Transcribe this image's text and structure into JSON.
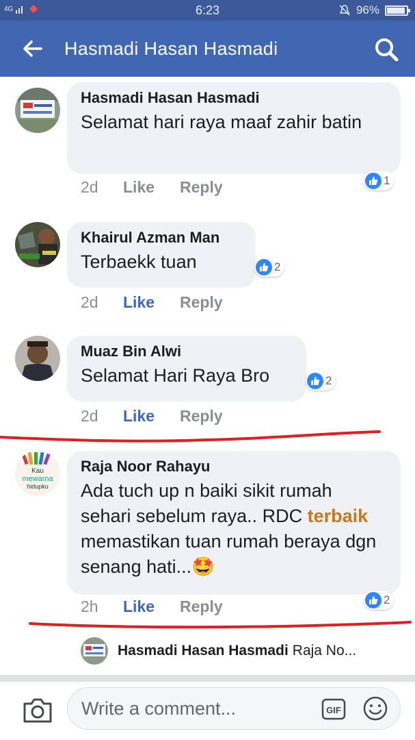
{
  "status_bar": {
    "network": "4G",
    "time": "6:23",
    "battery": "96%"
  },
  "header": {
    "title": "Hasmadi Hasan Hasmadi",
    "back_icon": "arrow-left-icon",
    "search_icon": "search-icon"
  },
  "comments": [
    {
      "author": "Hasmadi Hasan Hasmadi",
      "text": "Selamat hari raya maaf zahir batin",
      "time": "2d",
      "like": "Like",
      "reply": "Reply",
      "reactions": "1",
      "liked": false
    },
    {
      "author": "Khairul Azman Man",
      "text": "Terbaekk tuan",
      "time": "2d",
      "like": "Like",
      "reply": "Reply",
      "reactions": "2",
      "liked": true
    },
    {
      "author": "Muaz Bin Alwi",
      "text": "Selamat Hari Raya Bro",
      "time": "2d",
      "like": "Like",
      "reply": "Reply",
      "reactions": "2",
      "liked": true
    },
    {
      "author": "Raja Noor Rahayu",
      "text_parts": [
        "Ada tuch up n baiki sikit rumah sehari sebelum raya.. RDC ",
        "terbaik",
        " memastikan tuan rumah beraya dgn senang hati...",
        "🤩"
      ],
      "time": "2h",
      "like": "Like",
      "reply": "Reply",
      "reactions": "2",
      "liked": true,
      "avatar_text": [
        "Kau",
        "mewarna",
        "hidupku"
      ]
    }
  ],
  "reply_preview": {
    "author": "Hasmadi Hasan Hasmadi",
    "snippet": "Raja No..."
  },
  "composer": {
    "placeholder": "Write a comment...",
    "gif_label": "GIF"
  },
  "colors": {
    "header": "#4267b2",
    "status": "#3b5998",
    "like_blue": "#4267b2",
    "reaction_blue": "#2d88ff",
    "annotation_red": "#e02020",
    "highlight": "#c47a1b"
  }
}
